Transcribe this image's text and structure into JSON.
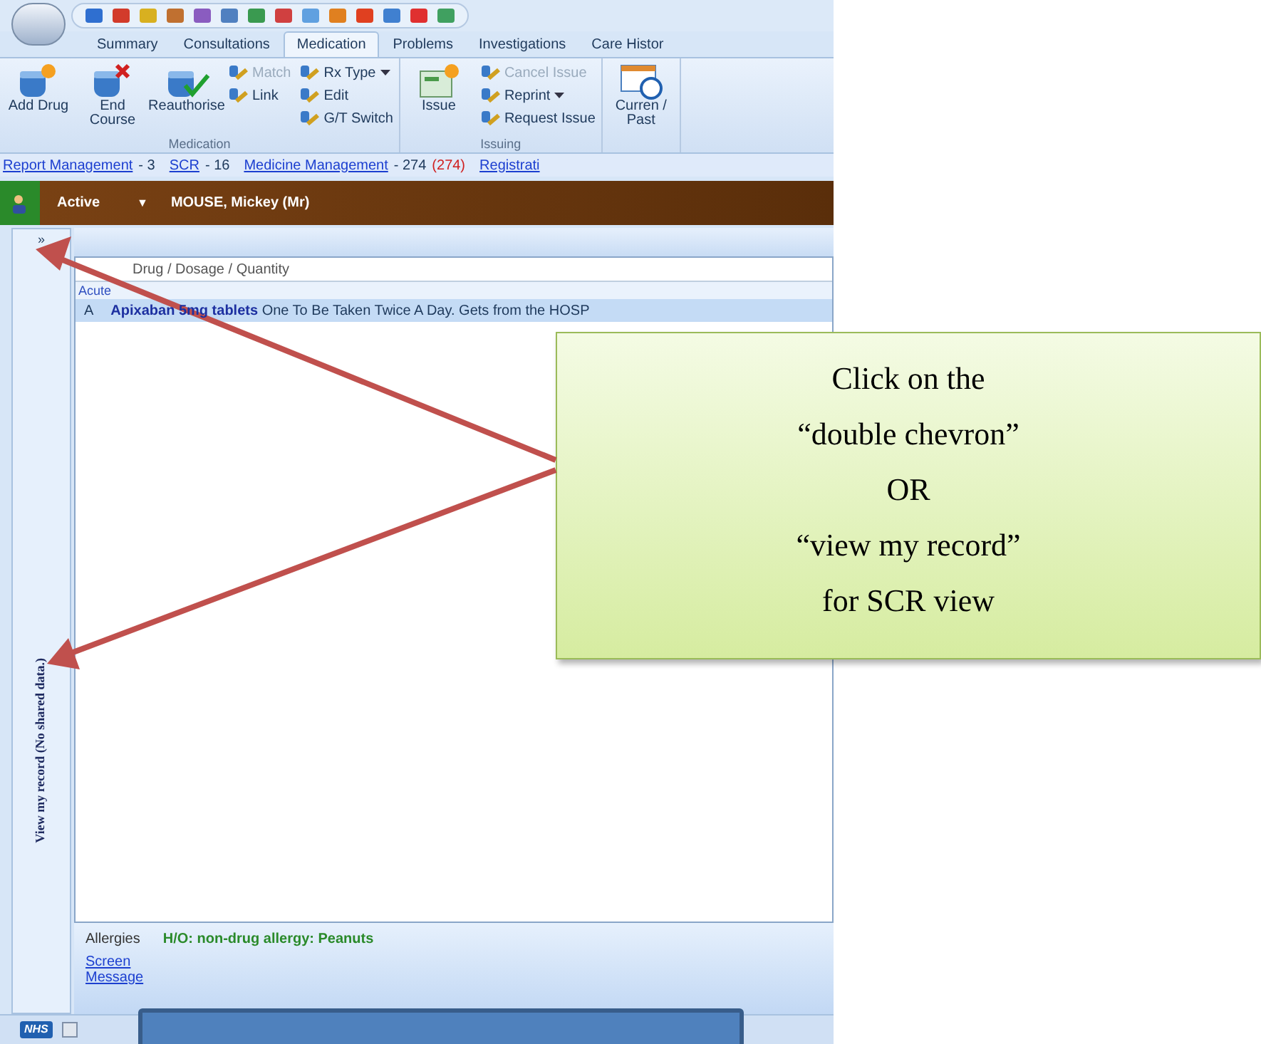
{
  "tabs": [
    {
      "label": "Summary",
      "selected": false
    },
    {
      "label": "Consultations",
      "selected": false
    },
    {
      "label": "Medication",
      "selected": true
    },
    {
      "label": "Problems",
      "selected": false
    },
    {
      "label": "Investigations",
      "selected": false
    },
    {
      "label": "Care Histor",
      "selected": false
    }
  ],
  "ribbon": {
    "groups": [
      {
        "label": "Medication",
        "large": [
          {
            "label": "Add Drug"
          },
          {
            "label": "End Course"
          },
          {
            "label": "Reauthorise"
          }
        ],
        "columns": [
          [
            {
              "label": "Match",
              "disabled": true,
              "dropdown": false
            },
            {
              "label": "Link",
              "disabled": false,
              "dropdown": false
            }
          ],
          [
            {
              "label": "Rx Type",
              "disabled": false,
              "dropdown": true
            },
            {
              "label": "Edit",
              "disabled": false,
              "dropdown": false
            },
            {
              "label": "G/T Switch",
              "disabled": false,
              "dropdown": false
            }
          ]
        ]
      },
      {
        "label": "Issuing",
        "large": [
          {
            "label": "Issue"
          }
        ],
        "columns": [
          [
            {
              "label": "Cancel Issue",
              "disabled": true,
              "dropdown": false
            },
            {
              "label": "Reprint",
              "disabled": false,
              "dropdown": true
            },
            {
              "label": "Request Issue",
              "disabled": false,
              "dropdown": false
            }
          ]
        ]
      },
      {
        "large": [
          {
            "label": "Curren / Past"
          }
        ]
      }
    ]
  },
  "links": [
    {
      "label": "Report Management",
      "count": "- 3"
    },
    {
      "label": "SCR",
      "count": "- 16"
    },
    {
      "label": "Medicine Management",
      "count": "- 274",
      "extra": "(274)"
    },
    {
      "label": "Registrati"
    }
  ],
  "patient": {
    "status": "Active",
    "marker": "▼",
    "name": "MOUSE, Mickey (Mr)"
  },
  "side_panel": {
    "expand": "»",
    "label": "View my record (No shared data.)"
  },
  "table": {
    "columns": [
      "Drug / Dosage / Quantity"
    ],
    "group": "Acute",
    "rows": [
      {
        "code": "A",
        "drug": "Apixaban 5mg tablets",
        "dosage": "One To Be Taken Twice A Day. Gets from the HOSP",
        "selected": true
      }
    ]
  },
  "footer": {
    "allergies_label": "Allergies",
    "allergies": "H/O: non-drug allergy: Peanuts",
    "links": [
      "Screen",
      "Message"
    ]
  },
  "status_bar": {
    "logo": "NHS"
  },
  "callout": {
    "lines": [
      "Click on the",
      "“double chevron”",
      "OR",
      "“view my record”",
      "for SCR view"
    ]
  }
}
